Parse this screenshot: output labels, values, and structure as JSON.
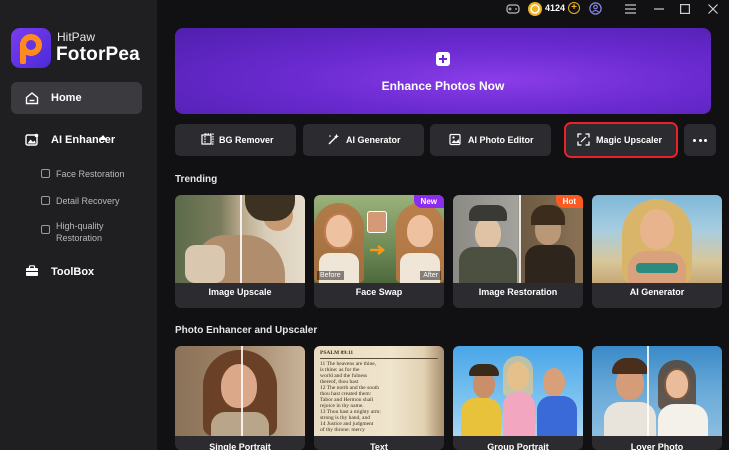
{
  "app": {
    "brand_small": "HitPaw",
    "brand_name": "FotorPea"
  },
  "titlebar": {
    "credits": "4124"
  },
  "sidebar": {
    "home": "Home",
    "ai_enhancer": "AI Enhancer",
    "sub_items": [
      "Face Restoration",
      "Detail Recovery",
      "High-quality",
      "Restoration"
    ],
    "toolbox": "ToolBox"
  },
  "hero": {
    "title": "Enhance Photos Now"
  },
  "tools": [
    "BG Remover",
    "AI Generator",
    "AI Photo Editor",
    "Magic Upscaler"
  ],
  "trending": {
    "title": "Trending",
    "cards": [
      {
        "caption": "Image Upscale"
      },
      {
        "caption": "Face Swap",
        "badge": "New",
        "before": "Before",
        "after": "After"
      },
      {
        "caption": "Image Restoration",
        "badge": "Hot"
      },
      {
        "caption": "AI Generator"
      }
    ]
  },
  "enhancer": {
    "title": "Photo Enhancer and Upscaler",
    "cards": [
      {
        "caption": "Single Portrait"
      },
      {
        "caption": "Text"
      },
      {
        "caption": "Group Portrait"
      },
      {
        "caption": "Lover Photo"
      }
    ],
    "book": {
      "heading": "PSALM 89:11",
      "lines": [
        "11 The heavens are thine,",
        "is thine: as for the",
        "world and the fulness",
        "thereof, thou hast",
        "12 The north and the south",
        "thou hast created them:",
        "Tabor and Hermon shall",
        "rejoice in thy name.",
        "13 Thou hast a mighty arm:",
        "strong is thy hand, and",
        "14 Justice and judgment",
        "of thy throne: mercy"
      ]
    }
  },
  "colors": {
    "accent": "#6a2ad0",
    "highlight": "#e8212a",
    "coin": "#f0b21e",
    "new_badge": "#8b2cf0",
    "hot_badge": "#ff5a1f"
  }
}
